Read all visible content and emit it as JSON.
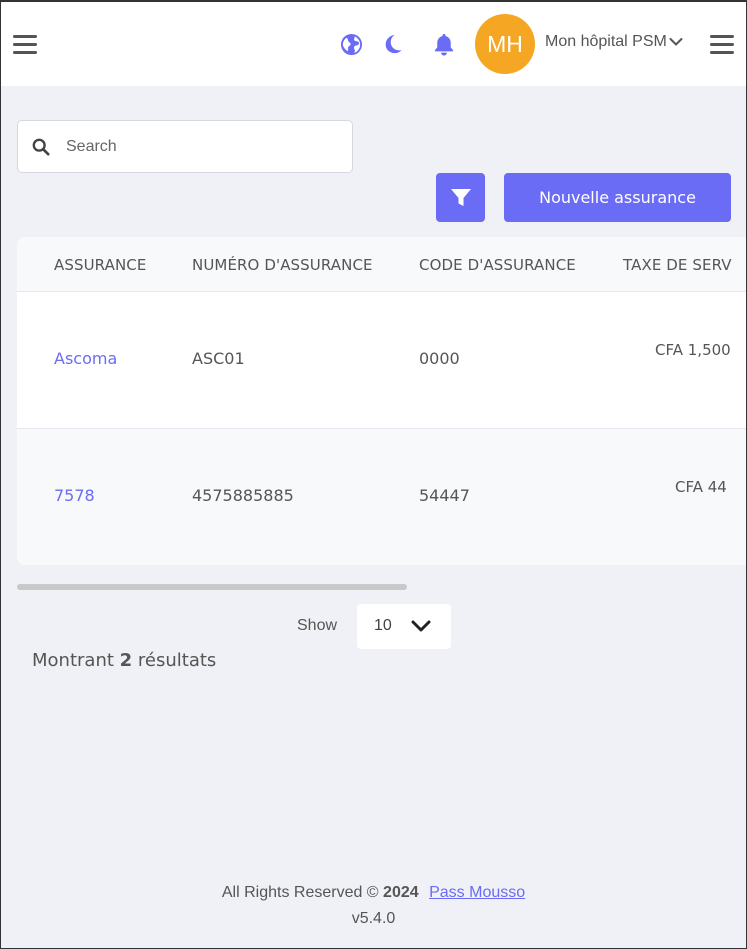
{
  "header": {
    "avatar_initials": "MH",
    "hospital_name": "Mon hôpital PSM",
    "icons": [
      "menu-icon",
      "globe-icon",
      "moon-icon",
      "bell-icon",
      "chevron-down-icon",
      "menu-icon"
    ],
    "accent_color": "#6a6cf6",
    "avatar_color": "#f5a623"
  },
  "toolbar": {
    "search_placeholder": "Search",
    "new_button_label": "Nouvelle assurance"
  },
  "table": {
    "columns": [
      "ASSURANCE",
      "NUMÉRO D'ASSURANCE",
      "CODE D'ASSURANCE",
      "TAXE DE SERV"
    ],
    "rows": [
      {
        "assurance": "Ascoma",
        "numero": "ASC01",
        "code": "0000",
        "taxe": "CFA 1,500"
      },
      {
        "assurance": "7578",
        "numero": "4575885885",
        "code": "54447",
        "taxe": "CFA 44"
      }
    ]
  },
  "pagination": {
    "show_label": "Show",
    "page_size": "10",
    "results_prefix": "Montrant",
    "results_count": "2",
    "results_suffix": "résultats"
  },
  "footer": {
    "rights": "All Rights Reserved ©",
    "year": "2024",
    "link_text": "Pass Mousso",
    "version": "v5.4.0"
  }
}
